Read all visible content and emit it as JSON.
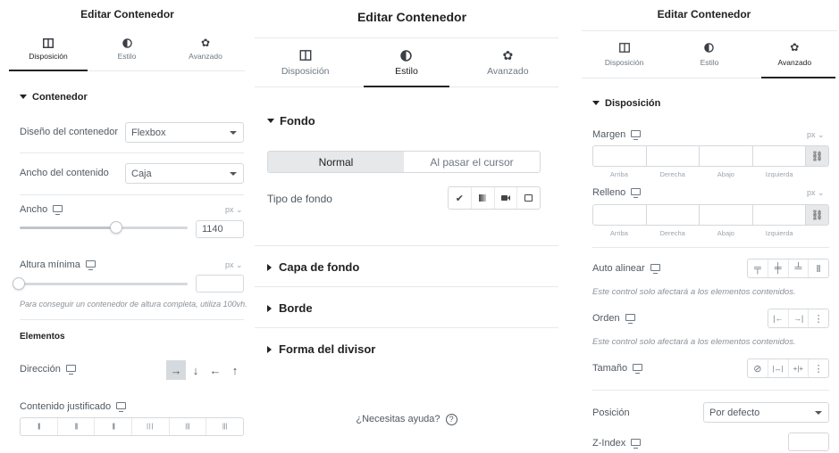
{
  "panel_left": {
    "title": "Editar Contenedor",
    "tabs": [
      {
        "label": "Disposición",
        "icon": "layout-columns-icon"
      },
      {
        "label": "Estilo",
        "icon": "half-circle-icon"
      },
      {
        "label": "Avanzado",
        "icon": "gear-icon"
      }
    ],
    "active_tab": "Disposición",
    "section_title": "Contenedor",
    "container_layout_label": "Diseño del contenedor",
    "container_layout_value": "Flexbox",
    "content_width_label": "Ancho del contenido",
    "content_width_value": "Caja",
    "width_label": "Ancho",
    "width_unit": "px ⌄",
    "width_value": "1140",
    "min_height_label": "Altura mínima",
    "min_height_unit": "px ⌄",
    "min_height_value": "",
    "min_height_note": "Para conseguir un contenedor de altura completa, utiliza 100vh.",
    "elements_heading": "Elementos",
    "direction_label": "Dirección",
    "direction_options": [
      "→",
      "↓",
      "←",
      "↑"
    ],
    "justify_label": "Contenido justificado",
    "justify_options": [
      "|||",
      "|||",
      "|||",
      "|||",
      "|||",
      "|||"
    ]
  },
  "panel_middle": {
    "title": "Editar Contenedor",
    "tabs": [
      {
        "label": "Disposición",
        "icon": "layout-columns-icon"
      },
      {
        "label": "Estilo",
        "icon": "half-circle-icon"
      },
      {
        "label": "Avanzado",
        "icon": "gear-icon"
      }
    ],
    "active_tab": "Estilo",
    "background_section": "Fondo",
    "toggle_normal": "Normal",
    "toggle_hover": "Al pasar el cursor",
    "background_type_label": "Tipo de fondo",
    "background_type_icons": [
      "brush-icon",
      "gradient-icon",
      "video-icon",
      "slideshow-icon"
    ],
    "sections": [
      "Capa de fondo",
      "Borde",
      "Forma del divisor"
    ],
    "help_text": "¿Necesitas ayuda?",
    "help_icon": "?"
  },
  "panel_right": {
    "title": "Editar Contenedor",
    "tabs": [
      {
        "label": "Disposición",
        "icon": "layout-columns-icon"
      },
      {
        "label": "Estilo",
        "icon": "half-circle-icon"
      },
      {
        "label": "Avanzado",
        "icon": "gear-icon"
      }
    ],
    "active_tab": "Avanzado",
    "section_title": "Disposición",
    "margin_label": "Margen",
    "margin_unit": "px ⌄",
    "padding_label": "Relleno",
    "padding_unit": "px ⌄",
    "dimension_labels": [
      "Arriba",
      "Derecha",
      "Abajo",
      "Izquierda"
    ],
    "link_icon": "⛓",
    "align_self_label": "Auto alinear",
    "align_self_options": [
      "╤",
      "╪",
      "╧",
      "Ⅱ"
    ],
    "align_note": "Este control solo afectará a los elementos contenidos.",
    "order_label": "Orden",
    "order_options": [
      "|←",
      "→|",
      "⋮"
    ],
    "order_note": "Este control solo afectará a los elementos contenidos.",
    "size_label": "Tamaño",
    "size_options": [
      "⊘",
      "|↔|",
      "+|+",
      "⋮"
    ],
    "position_label": "Posición",
    "position_value": "Por defecto",
    "zindex_label": "Z-Index",
    "zindex_value": ""
  },
  "colors": {
    "active_toggle": "#e6e8ea",
    "active_direction": "#d5dadf",
    "border": "#d5d8dc",
    "text": "#515962",
    "heading": "#222222"
  }
}
